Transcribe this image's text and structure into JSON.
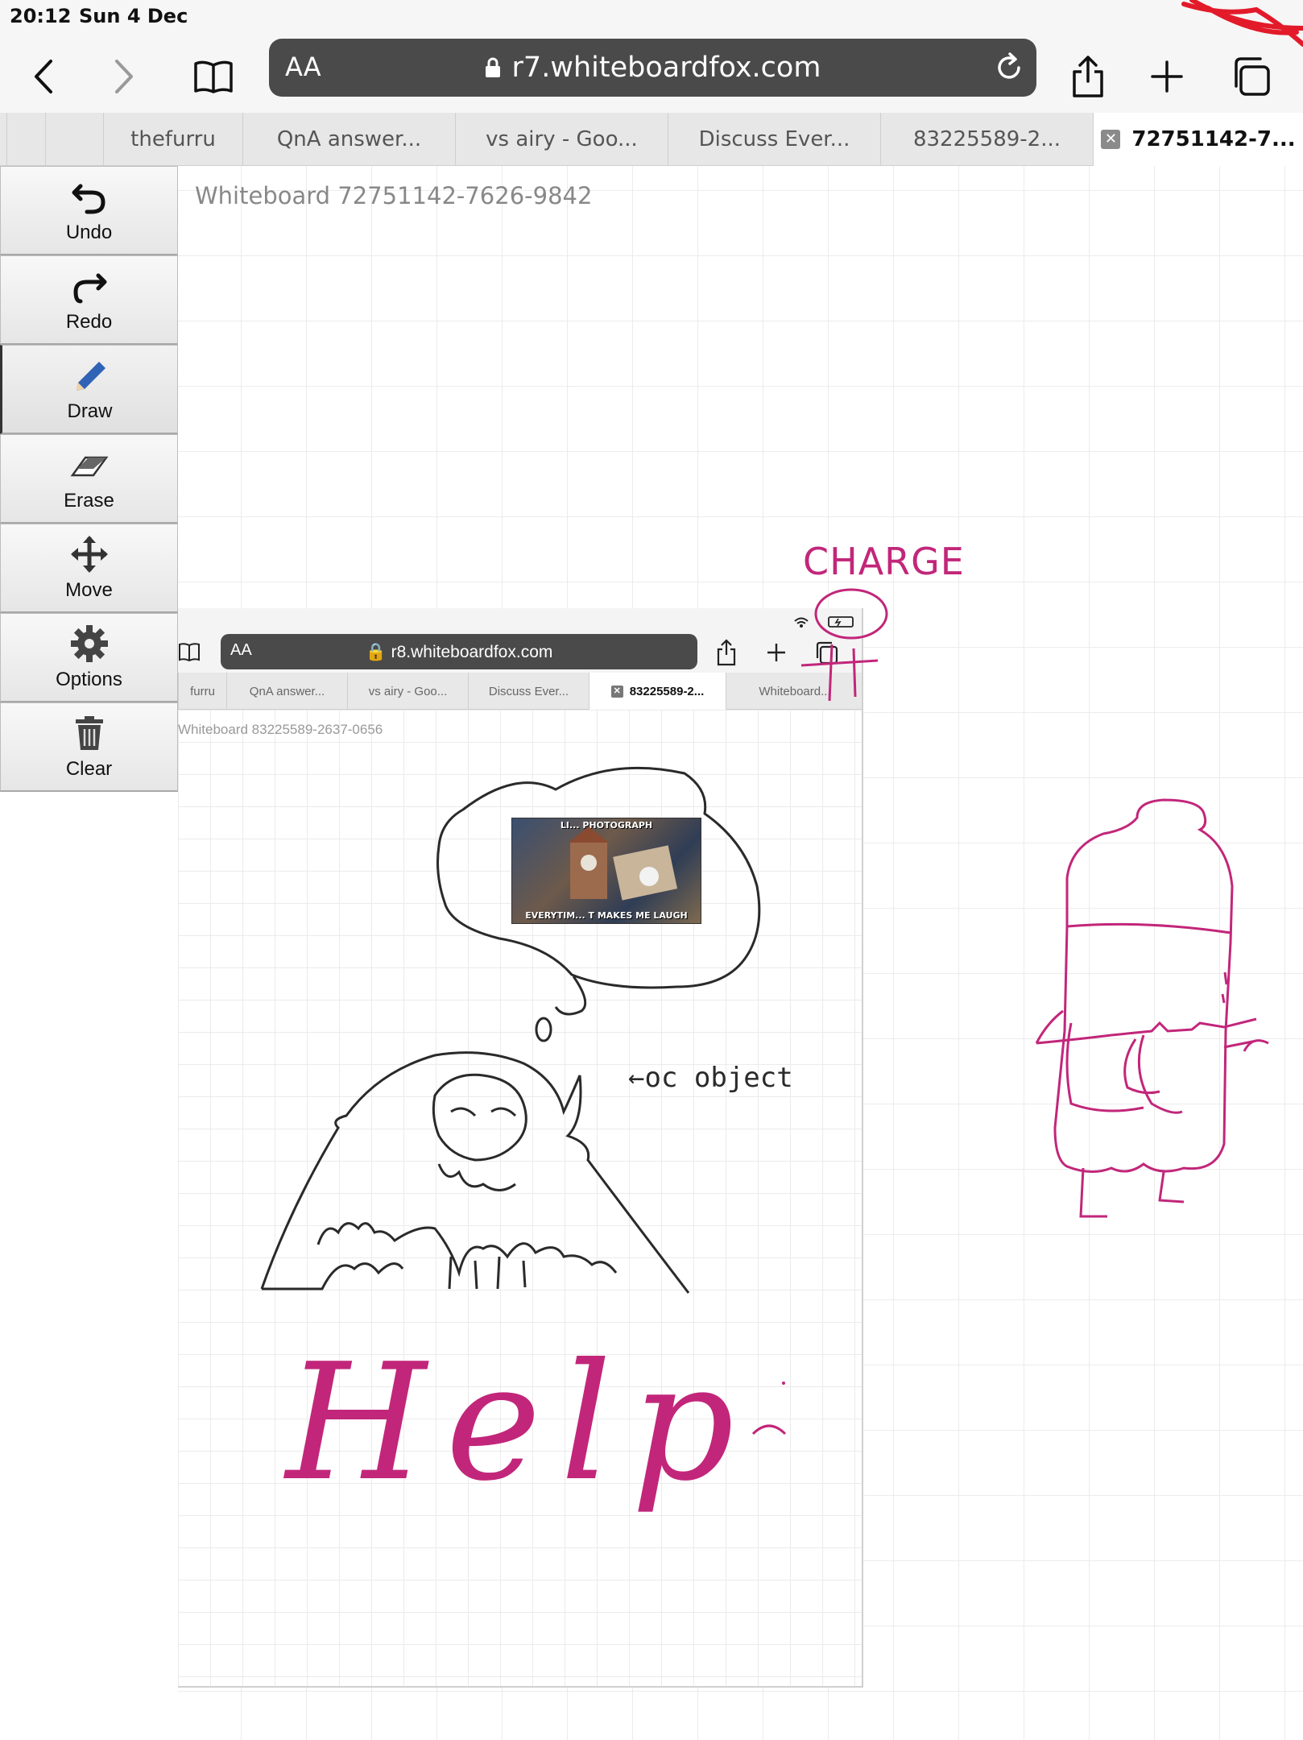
{
  "status": {
    "time": "20:12",
    "date": "Sun 4 Dec"
  },
  "browser": {
    "url_aa": "AA",
    "url": "r7.whiteboardfox.com",
    "tabs": [
      "thefurru",
      "QnA answer...",
      "vs airy - Goo...",
      "Discuss Ever...",
      "83225589-2...",
      "72751142-7..."
    ],
    "active_tab": 5
  },
  "tools": [
    "Undo",
    "Redo",
    "Draw",
    "Erase",
    "Move",
    "Options",
    "Clear"
  ],
  "whiteboard_title": "Whiteboard 72751142-7626-9842",
  "pasted": {
    "url_aa": "AA",
    "url": "r8.whiteboardfox.com",
    "tabs": [
      "furru",
      "QnA answer...",
      "vs airy - Goo...",
      "Discuss Ever...",
      "83225589-2...",
      "Whiteboard..."
    ],
    "title": "Whiteboard 83225589-2637-0656",
    "meme_top": "LI... PHOTOGRAPH",
    "meme_bottom": "EVERYTIM... T MAKES ME LAUGH"
  },
  "annotations": {
    "charge": "CHARGE",
    "oc_object": "←oc object",
    "help": "Help"
  },
  "colors": {
    "ink_pink": "#c2267a",
    "ink_black": "#2a2a2a"
  }
}
